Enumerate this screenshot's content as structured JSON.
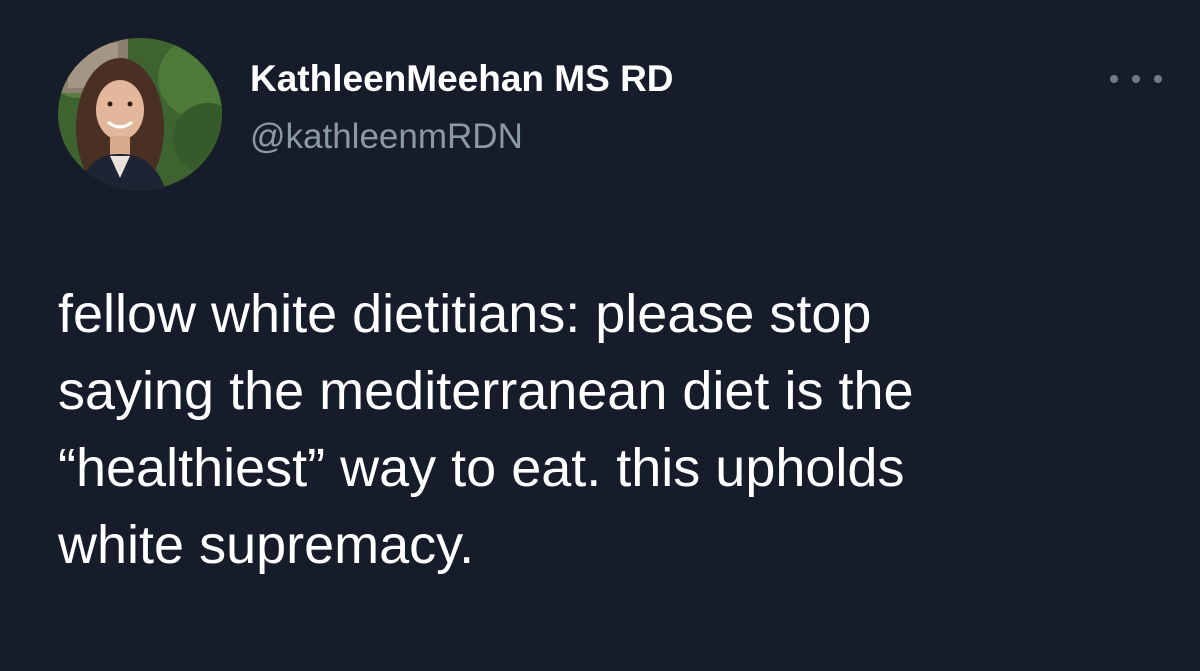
{
  "author": {
    "display_name": "KathleenMeehan MS RD",
    "handle": "@kathleenmRDN",
    "avatar_icon": "profile-photo"
  },
  "more_menu": {
    "icon": "more-horizontal-icon"
  },
  "tweet": {
    "lines": [
      "fellow white dietitians: please stop",
      "saying the mediterranean diet is the",
      "“healthiest” way to eat. this upholds",
      "white supremacy."
    ]
  },
  "colors": {
    "background": "#161c29",
    "text": "#ffffff",
    "secondary_text": "#8b98a5"
  }
}
